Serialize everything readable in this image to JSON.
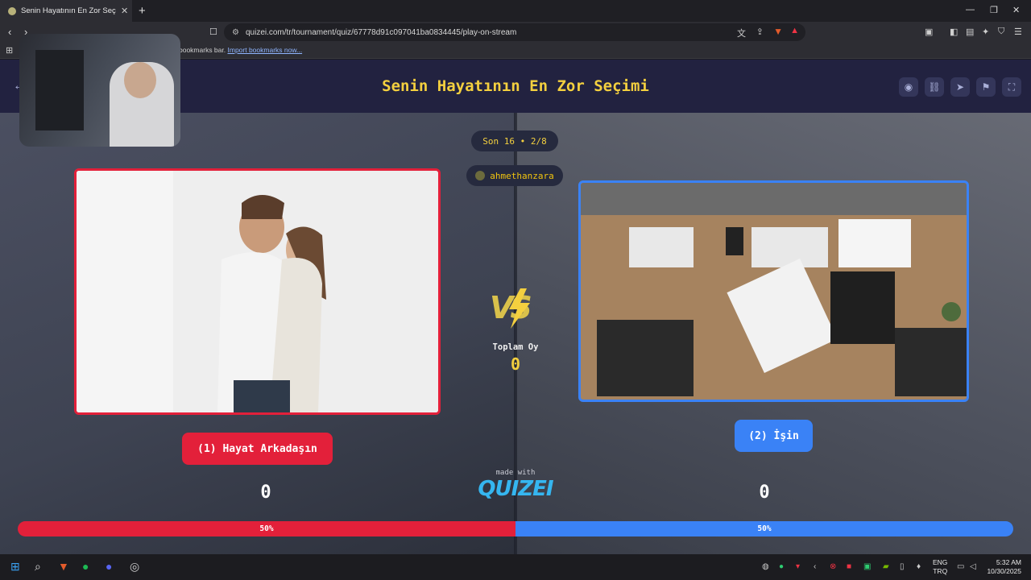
{
  "browser": {
    "tab_title": "Senin Hayatının En Zor Seçimi -",
    "tab_close": "✕",
    "new_tab": "+",
    "url": "quizei.com/tr/tournament/quiz/67778d91c097041ba0834445/play-on-stream",
    "bookmarks_text": "bookmarks bar.",
    "import_link": "Import bookmarks now..."
  },
  "header": {
    "title": "Senin Hayatının En Zor Seçimi",
    "icons": [
      "eye-icon",
      "link-icon",
      "send-icon",
      "flag-icon",
      "fullscreen-icon"
    ]
  },
  "round": {
    "label": "Son 16 • 2/8",
    "username": "ahmethanzara"
  },
  "vs": {
    "text": "VS",
    "total_label": "Toplam Oy",
    "total_value": "0"
  },
  "left": {
    "button_label": "(1) Hayat Arkadaşın",
    "count": "0",
    "percent_label": "50%",
    "percent": 50
  },
  "right": {
    "button_label": "(2) İşin",
    "count": "0",
    "percent_label": "50%",
    "percent": 50
  },
  "footer": {
    "made_with": "made with",
    "logo": "QUIZEI"
  },
  "taskbar": {
    "lang_top": "ENG",
    "lang_bottom": "TRQ",
    "time": "5:32 AM",
    "date": "10/30/2025"
  },
  "colors": {
    "left_accent": "#e3203a",
    "right_accent": "#3a82f6",
    "title_yellow": "#f4d03f",
    "header_bg": "#222240"
  }
}
